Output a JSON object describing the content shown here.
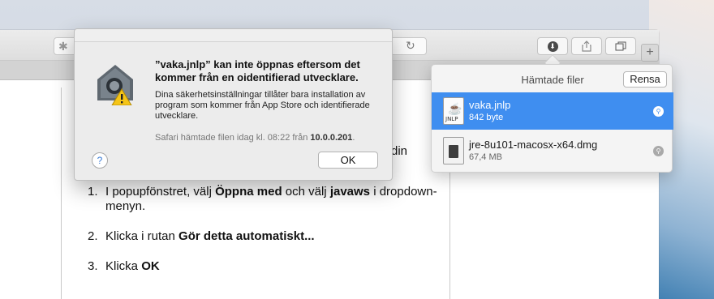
{
  "browser": {
    "toolbar": {
      "extensions_icon": "puzzle-icon",
      "reload_icon": "reload-icon",
      "downloads_icon": "download-icon",
      "share_icon": "share-icon",
      "tabs_icon": "tabs-icon",
      "new_tab_label": "+"
    }
  },
  "page": {
    "fragment": "din",
    "steps": [
      {
        "num": "1.",
        "parts": [
          "I popupfönstret, välj ",
          "Öppna med",
          " och välj ",
          "javaws",
          " i dropdown-menyn."
        ]
      },
      {
        "num": "2.",
        "parts": [
          "Klicka i rutan ",
          "Gör detta automatiskt..."
        ]
      },
      {
        "num": "3.",
        "parts": [
          "Klicka ",
          "OK"
        ]
      }
    ]
  },
  "downloads": {
    "title": "Hämtade filer",
    "clear_label": "Rensa",
    "items": [
      {
        "name": "vaka.jnlp",
        "size": "842 byte",
        "icon": "jnlp-file-icon",
        "icon_tag": "JNLP",
        "selected": true
      },
      {
        "name": "jre-8u101-macosx-x64.dmg",
        "size": "67,4 MB",
        "icon": "dmg-file-icon",
        "selected": false
      }
    ]
  },
  "alert": {
    "title": "”vaka.jnlp” kan inte öppnas eftersom det kommer från en oidentifierad utvecklare.",
    "body": "Dina säkerhetsinställningar tillåter bara installation av program som kommer från App Store och identifierade utvecklare.",
    "note_prefix": "Safari hämtade filen idag kl. 08:22 från ",
    "note_host": "10.0.0.201",
    "note_suffix": ".",
    "help_label": "?",
    "ok_label": "OK"
  },
  "colors": {
    "selection": "#3f8ef0",
    "warning": "#f5c518"
  }
}
